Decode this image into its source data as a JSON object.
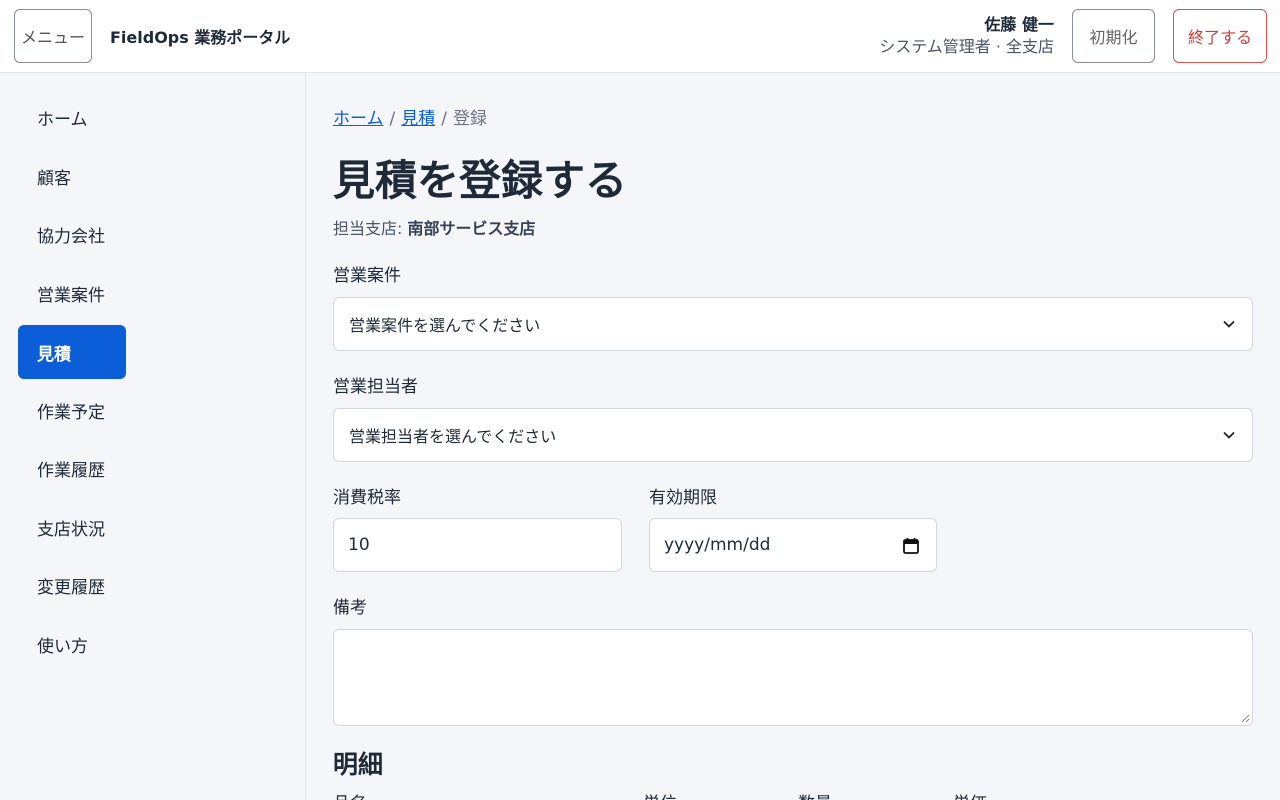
{
  "header": {
    "menu_label": "メニュー",
    "app_title": "FieldOps 業務ポータル",
    "user_name": "佐藤 健一",
    "user_role": "システム管理者 · 全支店",
    "reset_label": "初期化",
    "exit_label": "終了する"
  },
  "sidebar": {
    "items": [
      {
        "label": "ホーム"
      },
      {
        "label": "顧客"
      },
      {
        "label": "協力会社"
      },
      {
        "label": "営業案件"
      },
      {
        "label": "見積"
      },
      {
        "label": "作業予定"
      },
      {
        "label": "作業履歴"
      },
      {
        "label": "支店状況"
      },
      {
        "label": "変更履歴"
      },
      {
        "label": "使い方"
      }
    ],
    "active_item": "見積"
  },
  "breadcrumb": {
    "home": "ホーム",
    "estimates": "見積",
    "current": "登録"
  },
  "page": {
    "title": "見積を登録する",
    "branch_prefix": "担当支店:",
    "branch_name": "南部サービス支店"
  },
  "form": {
    "deal_label": "営業案件",
    "deal_placeholder": "営業案件を選んでください",
    "rep_label": "営業担当者",
    "rep_placeholder": "営業担当者を選んでください",
    "tax_label": "消費税率",
    "tax_value": "10",
    "expiry_label": "有効期限",
    "expiry_placeholder": "yyyy/mm/dd",
    "notes_label": "備考",
    "notes_value": ""
  },
  "details": {
    "title": "明細",
    "columns": [
      "品名",
      "単位",
      "数量",
      "単価"
    ]
  }
}
